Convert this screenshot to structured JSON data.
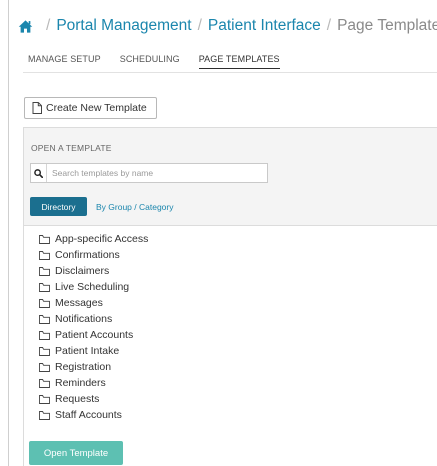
{
  "breadcrumb": {
    "home_icon": "home-icon",
    "items": [
      "Portal Management",
      "Patient Interface"
    ],
    "current": "Page Templates",
    "separator": "/"
  },
  "tabs": [
    {
      "label": "MANAGE SETUP",
      "active": false
    },
    {
      "label": "SCHEDULING",
      "active": false
    },
    {
      "label": "PAGE TEMPLATES",
      "active": true
    }
  ],
  "create_button": {
    "icon": "document-icon",
    "label": "Create New Template"
  },
  "panel": {
    "title": "OPEN A TEMPLATE",
    "search": {
      "icon": "search-icon",
      "placeholder": "Search templates by name",
      "value": ""
    },
    "view_toggle": {
      "directory_label": "Directory",
      "group_label": "By Group / Category",
      "active": "Directory"
    },
    "folders": [
      "App-specific Access",
      "Confirmations",
      "Disclaimers",
      "Live Scheduling",
      "Messages",
      "Notifications",
      "Patient Accounts",
      "Patient Intake",
      "Registration",
      "Reminders",
      "Requests",
      "Staff Accounts"
    ],
    "folder_icon": "folder-icon",
    "open_button_label": "Open Template"
  },
  "colors": {
    "link": "#1b86ad",
    "primary_button": "#1b6f8f",
    "open_button": "#5dc0b2",
    "breadcrumb_current": "#8a8a8a"
  }
}
